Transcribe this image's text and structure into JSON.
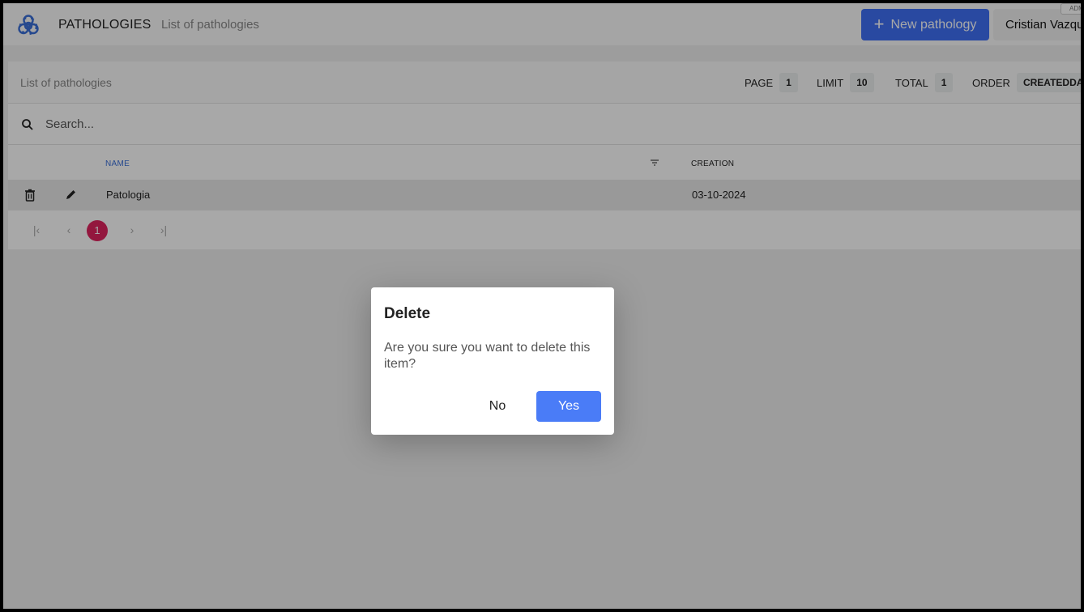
{
  "topbar": {
    "logo_icon": "biohazard-icon",
    "app_title": "PATHOLOGIES",
    "subtitle": "List of pathologies",
    "new_button_label": "New pathology",
    "user_name": "Cristian Vazquez",
    "user_badge": "ADM",
    "accent_color": "#3f6ff4"
  },
  "card": {
    "title": "List of pathologies",
    "meta": {
      "page_label": "PAGE",
      "page_value": "1",
      "limit_label": "LIMIT",
      "limit_value": "10",
      "total_label": "TOTAL",
      "total_value": "1",
      "order_label": "ORDER",
      "order_value": "CREATEDDATE"
    },
    "search_placeholder": "Search...",
    "columns": {
      "name": "NAME",
      "creation": "CREATION"
    },
    "rows": [
      {
        "name": "Patologia",
        "creation": "03-10-2024"
      }
    ],
    "pagination": {
      "current": "1"
    }
  },
  "dialog": {
    "title": "Delete",
    "message": "Are you sure you want to delete this item?",
    "no_label": "No",
    "yes_label": "Yes",
    "yes_color": "#4a7cf7"
  }
}
